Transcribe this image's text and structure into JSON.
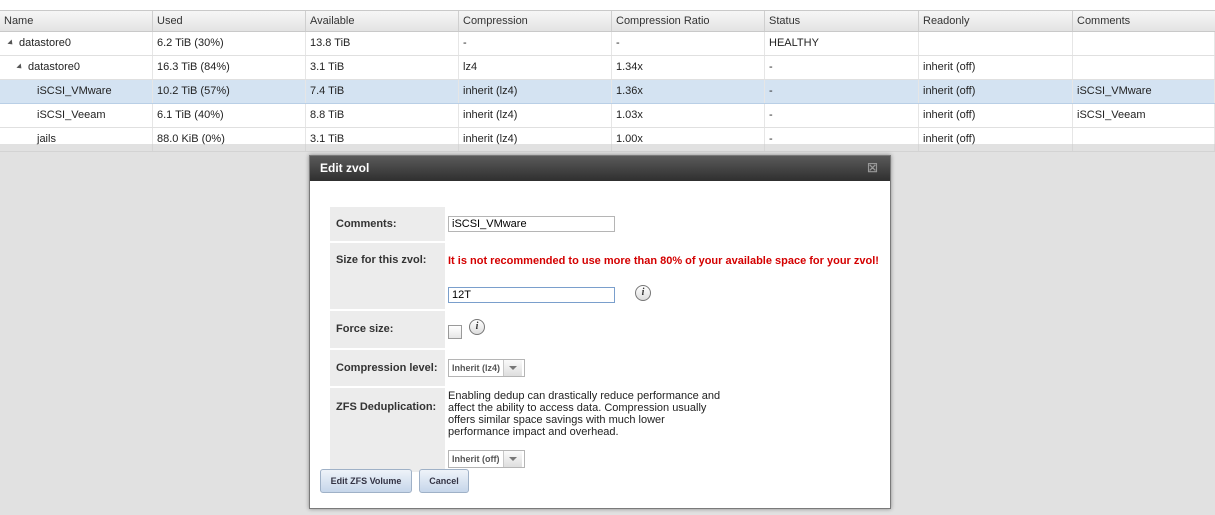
{
  "grid": {
    "columns": [
      "Name",
      "Used",
      "Available",
      "Compression",
      "Compression Ratio",
      "Status",
      "Readonly",
      "Comments"
    ],
    "rows": [
      {
        "name": "datastore0",
        "used": "6.2 TiB (30%)",
        "available": "13.8 TiB",
        "compression": "-",
        "ratio": "-",
        "status": "HEALTHY",
        "readonly": "",
        "comments": ""
      },
      {
        "name": "datastore0",
        "used": "16.3 TiB (84%)",
        "available": "3.1 TiB",
        "compression": "lz4",
        "ratio": "1.34x",
        "status": "-",
        "readonly": "inherit (off)",
        "comments": ""
      },
      {
        "name": "iSCSI_VMware",
        "used": "10.2 TiB (57%)",
        "available": "7.4 TiB",
        "compression": "inherit (lz4)",
        "ratio": "1.36x",
        "status": "-",
        "readonly": "inherit (off)",
        "comments": "iSCSI_VMware"
      },
      {
        "name": "iSCSI_Veeam",
        "used": "6.1 TiB (40%)",
        "available": "8.8 TiB",
        "compression": "inherit (lz4)",
        "ratio": "1.03x",
        "status": "-",
        "readonly": "inherit (off)",
        "comments": "iSCSI_Veeam"
      },
      {
        "name": "jails",
        "used": "88.0 KiB (0%)",
        "available": "3.1 TiB",
        "compression": "inherit (lz4)",
        "ratio": "1.00x",
        "status": "-",
        "readonly": "inherit (off)",
        "comments": ""
      }
    ]
  },
  "dialog": {
    "title": "Edit zvol",
    "close_icon": "close-icon",
    "comments_label": "Comments:",
    "comments_value": "iSCSI_VMware",
    "size_label": "Size for this zvol:",
    "size_warning": "It is not recommended to use more than 80% of your available space for your zvol!",
    "size_value": "12T",
    "force_label": "Force size:",
    "compression_label": "Compression level:",
    "compression_value": "Inherit (lz4)",
    "dedup_label": "ZFS Deduplication:",
    "dedup_help": "Enabling dedup can drastically reduce performance and affect the ability to access data. Compression usually offers similar space savings with much lower performance impact and overhead.",
    "dedup_value": "Inherit (off)",
    "submit_label": "Edit ZFS Volume",
    "cancel_label": "Cancel"
  }
}
